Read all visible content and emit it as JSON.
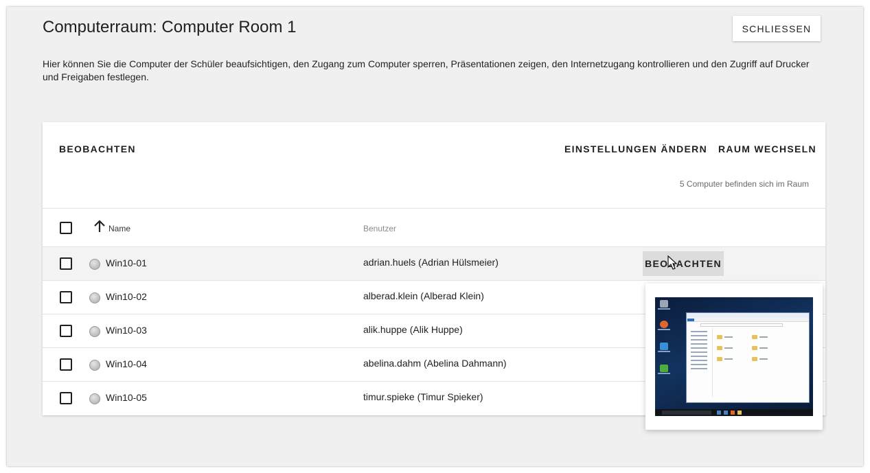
{
  "header": {
    "title": "Computerraum: Computer Room 1",
    "close_label": "SCHLIESSEN",
    "description": "Hier können Sie die Computer der Schüler beaufsichtigen, den Zugang zum Computer sperren, Präsentationen zeigen, den Internetzugang kontrollieren und den Zugriff auf Drucker und Freigaben festlegen."
  },
  "toolbar": {
    "observe_label": "BEOBACHTEN",
    "settings_label": "EINSTELLUNGEN ÄNDERN",
    "switch_room_label": "RAUM WECHSELN",
    "count_text": "5 Computer befinden sich im Raum"
  },
  "table": {
    "columns": {
      "name": "Name",
      "user": "Benutzer"
    },
    "sort": {
      "column": "Name",
      "direction": "ascending"
    },
    "rows": [
      {
        "computer": "Win10-01",
        "user": "adrian.huels (Adrian Hülsmeier)",
        "status": "offline-grey",
        "hovered": true
      },
      {
        "computer": "Win10-02",
        "user": "alberad.klein (Alberad Klein)",
        "status": "offline-grey"
      },
      {
        "computer": "Win10-03",
        "user": "alik.huppe (Alik Huppe)",
        "status": "offline-grey"
      },
      {
        "computer": "Win10-04",
        "user": "abelina.dahm (Abelina Dahmann)",
        "status": "offline-grey"
      },
      {
        "computer": "Win10-05",
        "user": "timur.spieke (Timur Spieker)",
        "status": "offline-grey"
      }
    ],
    "row_action_label": "BEOBACHTEN"
  },
  "popup": {
    "content": "screenshot-thumbnail"
  },
  "colors": {
    "background": "#f0f0f0",
    "card": "#ffffff",
    "hover_row": "#f3f3f3",
    "button_hover": "#dcdcdc"
  },
  "icons": [
    "arrow-up-icon",
    "status-dot-icon",
    "mouse-cursor-icon"
  ]
}
